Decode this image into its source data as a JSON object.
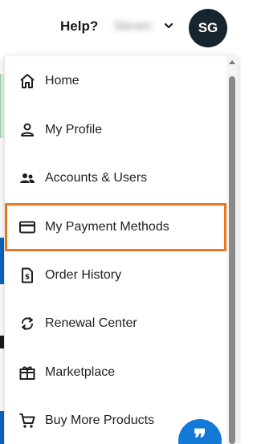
{
  "header": {
    "help_label": "Help?",
    "username": "Steven",
    "avatar_initials": "SG"
  },
  "menu": {
    "items": [
      {
        "label": "Home",
        "icon": "home-icon"
      },
      {
        "label": "My Profile",
        "icon": "person-icon"
      },
      {
        "label": "Accounts & Users",
        "icon": "people-icon"
      },
      {
        "label": "My Payment Methods",
        "icon": "credit-card-icon",
        "highlighted": true
      },
      {
        "label": "Order History",
        "icon": "receipt-icon"
      },
      {
        "label": "Renewal Center",
        "icon": "refresh-icon"
      },
      {
        "label": "Marketplace",
        "icon": "gift-icon"
      },
      {
        "label": "Buy More Products",
        "icon": "cart-icon"
      }
    ]
  },
  "chat": {
    "icon": "chat-quote-icon",
    "glyph": "❞"
  },
  "colors": {
    "highlight": "#e87722",
    "avatar_bg": "#18242e",
    "chat_bg": "#1279d6"
  }
}
